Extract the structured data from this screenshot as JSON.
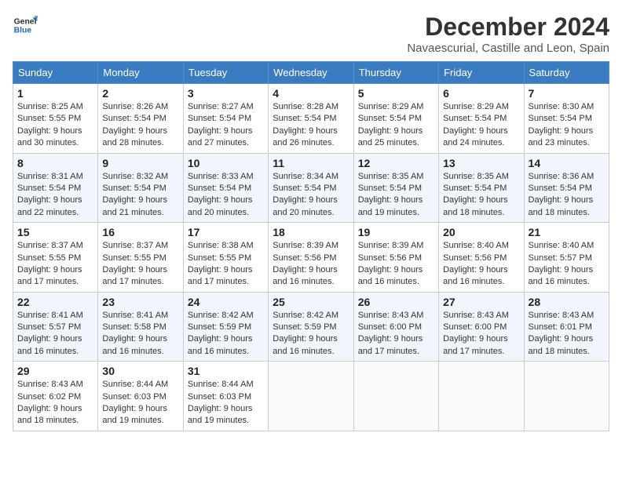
{
  "logo": {
    "line1": "General",
    "line2": "Blue"
  },
  "title": "December 2024",
  "subtitle": "Navaescurial, Castille and Leon, Spain",
  "headers": [
    "Sunday",
    "Monday",
    "Tuesday",
    "Wednesday",
    "Thursday",
    "Friday",
    "Saturday"
  ],
  "weeks": [
    [
      {
        "day": "1",
        "info": "Sunrise: 8:25 AM\nSunset: 5:55 PM\nDaylight: 9 hours\nand 30 minutes."
      },
      {
        "day": "2",
        "info": "Sunrise: 8:26 AM\nSunset: 5:54 PM\nDaylight: 9 hours\nand 28 minutes."
      },
      {
        "day": "3",
        "info": "Sunrise: 8:27 AM\nSunset: 5:54 PM\nDaylight: 9 hours\nand 27 minutes."
      },
      {
        "day": "4",
        "info": "Sunrise: 8:28 AM\nSunset: 5:54 PM\nDaylight: 9 hours\nand 26 minutes."
      },
      {
        "day": "5",
        "info": "Sunrise: 8:29 AM\nSunset: 5:54 PM\nDaylight: 9 hours\nand 25 minutes."
      },
      {
        "day": "6",
        "info": "Sunrise: 8:29 AM\nSunset: 5:54 PM\nDaylight: 9 hours\nand 24 minutes."
      },
      {
        "day": "7",
        "info": "Sunrise: 8:30 AM\nSunset: 5:54 PM\nDaylight: 9 hours\nand 23 minutes."
      }
    ],
    [
      {
        "day": "8",
        "info": "Sunrise: 8:31 AM\nSunset: 5:54 PM\nDaylight: 9 hours\nand 22 minutes."
      },
      {
        "day": "9",
        "info": "Sunrise: 8:32 AM\nSunset: 5:54 PM\nDaylight: 9 hours\nand 21 minutes."
      },
      {
        "day": "10",
        "info": "Sunrise: 8:33 AM\nSunset: 5:54 PM\nDaylight: 9 hours\nand 20 minutes."
      },
      {
        "day": "11",
        "info": "Sunrise: 8:34 AM\nSunset: 5:54 PM\nDaylight: 9 hours\nand 20 minutes."
      },
      {
        "day": "12",
        "info": "Sunrise: 8:35 AM\nSunset: 5:54 PM\nDaylight: 9 hours\nand 19 minutes."
      },
      {
        "day": "13",
        "info": "Sunrise: 8:35 AM\nSunset: 5:54 PM\nDaylight: 9 hours\nand 18 minutes."
      },
      {
        "day": "14",
        "info": "Sunrise: 8:36 AM\nSunset: 5:54 PM\nDaylight: 9 hours\nand 18 minutes."
      }
    ],
    [
      {
        "day": "15",
        "info": "Sunrise: 8:37 AM\nSunset: 5:55 PM\nDaylight: 9 hours\nand 17 minutes."
      },
      {
        "day": "16",
        "info": "Sunrise: 8:37 AM\nSunset: 5:55 PM\nDaylight: 9 hours\nand 17 minutes."
      },
      {
        "day": "17",
        "info": "Sunrise: 8:38 AM\nSunset: 5:55 PM\nDaylight: 9 hours\nand 17 minutes."
      },
      {
        "day": "18",
        "info": "Sunrise: 8:39 AM\nSunset: 5:56 PM\nDaylight: 9 hours\nand 16 minutes."
      },
      {
        "day": "19",
        "info": "Sunrise: 8:39 AM\nSunset: 5:56 PM\nDaylight: 9 hours\nand 16 minutes."
      },
      {
        "day": "20",
        "info": "Sunrise: 8:40 AM\nSunset: 5:56 PM\nDaylight: 9 hours\nand 16 minutes."
      },
      {
        "day": "21",
        "info": "Sunrise: 8:40 AM\nSunset: 5:57 PM\nDaylight: 9 hours\nand 16 minutes."
      }
    ],
    [
      {
        "day": "22",
        "info": "Sunrise: 8:41 AM\nSunset: 5:57 PM\nDaylight: 9 hours\nand 16 minutes."
      },
      {
        "day": "23",
        "info": "Sunrise: 8:41 AM\nSunset: 5:58 PM\nDaylight: 9 hours\nand 16 minutes."
      },
      {
        "day": "24",
        "info": "Sunrise: 8:42 AM\nSunset: 5:59 PM\nDaylight: 9 hours\nand 16 minutes."
      },
      {
        "day": "25",
        "info": "Sunrise: 8:42 AM\nSunset: 5:59 PM\nDaylight: 9 hours\nand 16 minutes."
      },
      {
        "day": "26",
        "info": "Sunrise: 8:43 AM\nSunset: 6:00 PM\nDaylight: 9 hours\nand 17 minutes."
      },
      {
        "day": "27",
        "info": "Sunrise: 8:43 AM\nSunset: 6:00 PM\nDaylight: 9 hours\nand 17 minutes."
      },
      {
        "day": "28",
        "info": "Sunrise: 8:43 AM\nSunset: 6:01 PM\nDaylight: 9 hours\nand 18 minutes."
      }
    ],
    [
      {
        "day": "29",
        "info": "Sunrise: 8:43 AM\nSunset: 6:02 PM\nDaylight: 9 hours\nand 18 minutes."
      },
      {
        "day": "30",
        "info": "Sunrise: 8:44 AM\nSunset: 6:03 PM\nDaylight: 9 hours\nand 19 minutes."
      },
      {
        "day": "31",
        "info": "Sunrise: 8:44 AM\nSunset: 6:03 PM\nDaylight: 9 hours\nand 19 minutes."
      },
      {
        "day": "",
        "info": ""
      },
      {
        "day": "",
        "info": ""
      },
      {
        "day": "",
        "info": ""
      },
      {
        "day": "",
        "info": ""
      }
    ]
  ]
}
